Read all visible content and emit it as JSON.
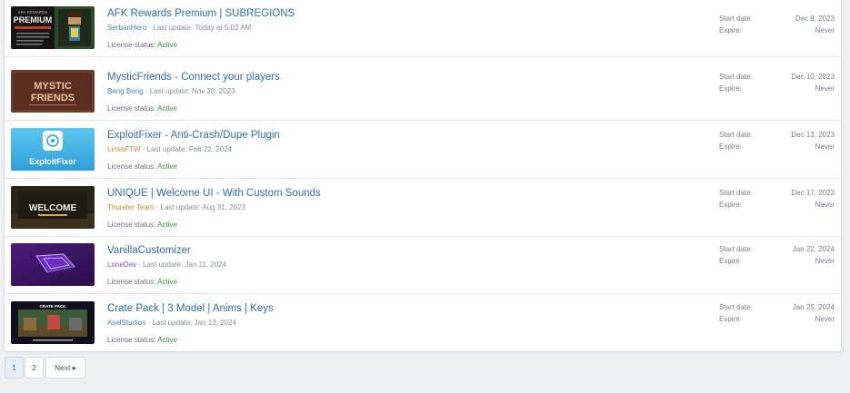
{
  "licenses": [
    {
      "title": "AFK Rewards Premium | SUBREGIONS",
      "author": "SerbanHero",
      "updated": "· Last update: Today at 5:02 AM",
      "license_label": "License status:",
      "status": "Active",
      "start_label": "Start date:",
      "start": "Dec 8, 2023",
      "expire_label": "Expire:",
      "expire": "Never",
      "thumb_text": [
        "AFK REWARDS",
        "PREMIUM"
      ]
    },
    {
      "title": "MysticFriends - Connect your players",
      "author": "Beng Beng",
      "updated": "· Last update: Nov 20, 2023",
      "license_label": "License status:",
      "status": "Active",
      "start_label": "Start date:",
      "start": "Dec 10, 2023",
      "expire_label": "Expire:",
      "expire": "Never",
      "thumb_text": [
        "MYSTIC",
        "FRIENDS"
      ]
    },
    {
      "title": "ExploitFixer - Anti-Crash/Dupe Plugin",
      "author": "LinsaFTW",
      "updated": "· Last update: Feb 22, 2024",
      "license_label": "License status:",
      "status": "Active",
      "start_label": "Start date:",
      "start": "Dec 13, 2023",
      "expire_label": "Expire:",
      "expire": "Never",
      "thumb_text": [
        "ExploitFixer"
      ]
    },
    {
      "title": "UNIQUE | Welcome UI - With Custom Sounds",
      "author": "Thunder Team",
      "updated": "· Last update: Aug 31, 2023",
      "license_label": "License status:",
      "status": "Active",
      "start_label": "Start date:",
      "start": "Dec 17, 2023",
      "expire_label": "Expire:",
      "expire": "Never",
      "thumb_text": [
        "WELCOME"
      ]
    },
    {
      "title": "VanillaCustomizer",
      "author": "LoneDev",
      "updated": "· Last update: Jan 11, 2024",
      "license_label": "License status:",
      "status": "Active",
      "start_label": "Start date:",
      "start": "Jan 22, 2024",
      "expire_label": "Expire:",
      "expire": "Never",
      "thumb_text": []
    },
    {
      "title": "Crate Pack | 3 Model | Anims | Keys",
      "author": "AselStudios",
      "updated": "· Last update: Jan 13, 2024",
      "license_label": "License status:",
      "status": "Active",
      "start_label": "Start date:",
      "start": "Jan 25, 2024",
      "expire_label": "Expire:",
      "expire": "Never",
      "thumb_text": [
        "CRATE PACK"
      ]
    }
  ],
  "pagination": {
    "page1": "1",
    "page2": "2",
    "next": "Next ▸"
  },
  "colors": {
    "link": "#2f6fb5",
    "active_status": "#3f8f3f",
    "author_orange": "#d98a3a",
    "author_purple": "#8a4fd1"
  }
}
